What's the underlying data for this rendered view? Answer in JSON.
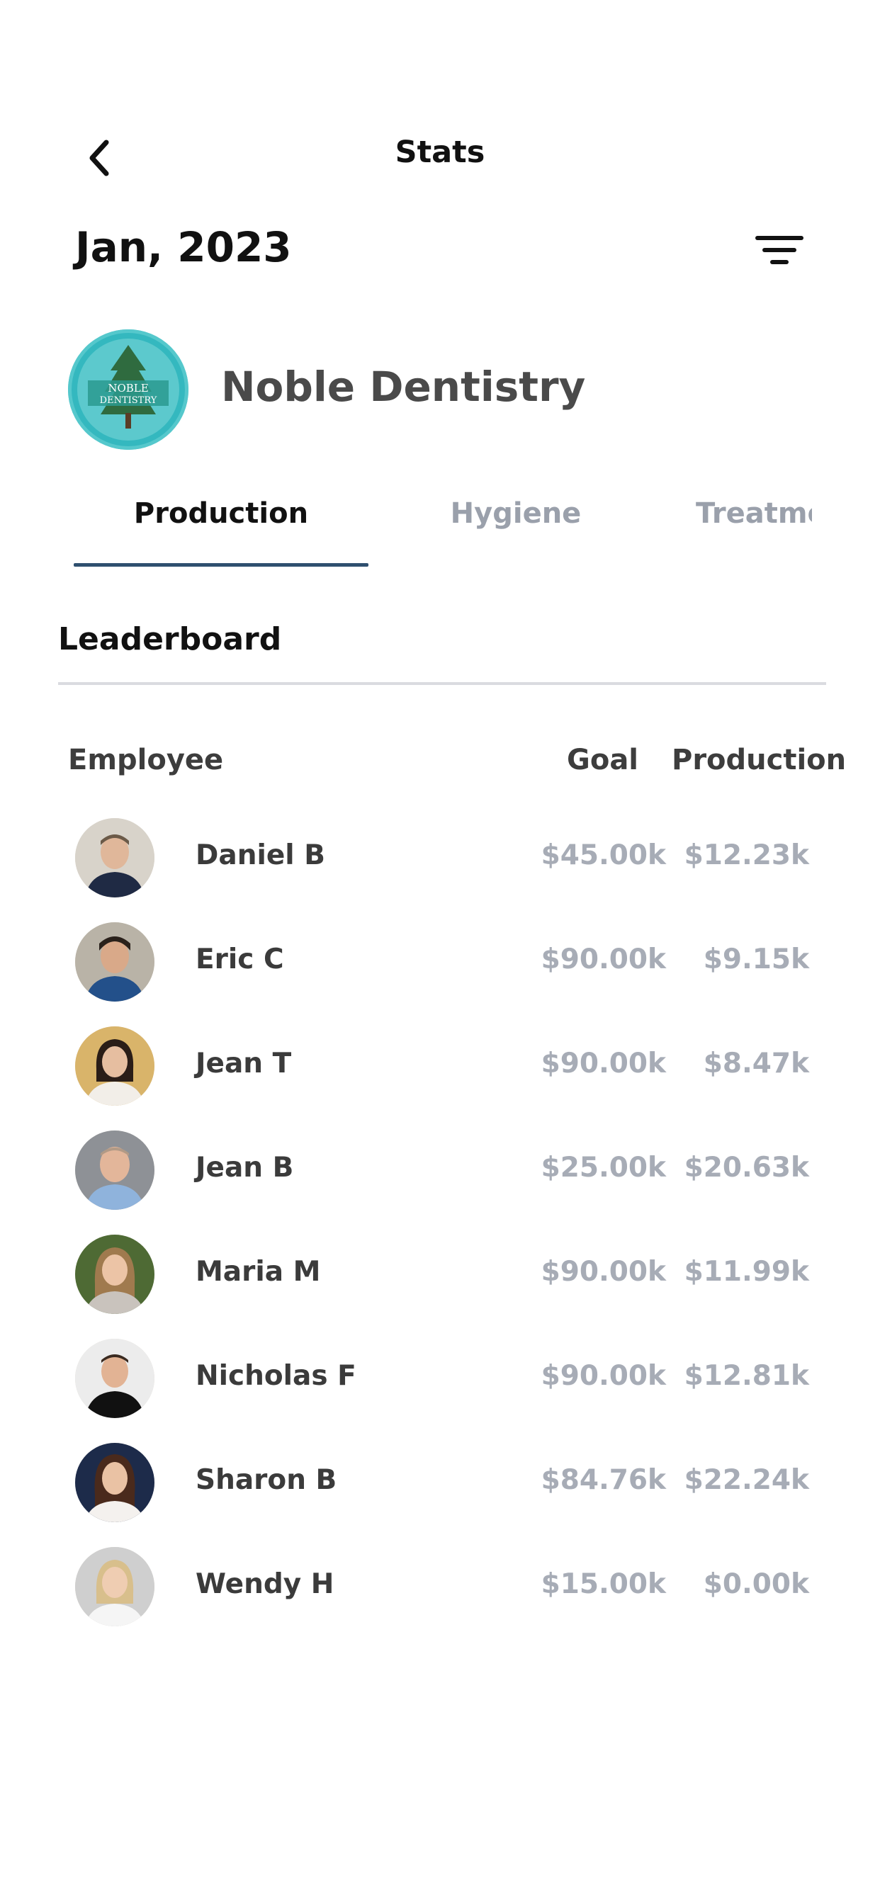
{
  "header": {
    "title": "Stats",
    "back_icon": "chevron-left-icon",
    "filter_icon": "filter-icon"
  },
  "period": {
    "label": "Jan, 2023"
  },
  "practice": {
    "name": "Noble Dentistry",
    "logo_text_line1": "NOBLE",
    "logo_text_line2": "DENTISTRY",
    "logo_color": "#32b7be"
  },
  "tabs": [
    {
      "label": "Production",
      "active": true
    },
    {
      "label": "Hygiene",
      "active": false
    },
    {
      "label": "Treatment",
      "active": false
    }
  ],
  "leaderboard": {
    "title": "Leaderboard",
    "columns": {
      "employee": "Employee",
      "goal": "Goal",
      "production": "Production"
    },
    "rows": [
      {
        "name": "Daniel B",
        "goal": "$45.00k",
        "production": "$12.23k"
      },
      {
        "name": "Eric C",
        "goal": "$90.00k",
        "production": "$9.15k"
      },
      {
        "name": "Jean T",
        "goal": "$90.00k",
        "production": "$8.47k"
      },
      {
        "name": "Jean B",
        "goal": "$25.00k",
        "production": "$20.63k"
      },
      {
        "name": "Maria M",
        "goal": "$90.00k",
        "production": "$11.99k"
      },
      {
        "name": "Nicholas F",
        "goal": "$90.00k",
        "production": "$12.81k"
      },
      {
        "name": "Sharon B",
        "goal": "$84.76k",
        "production": "$22.24k"
      },
      {
        "name": "Wendy H",
        "goal": "$15.00k",
        "production": "$0.00k"
      }
    ]
  },
  "colors": {
    "accent": "#2f4f6f",
    "muted_text": "#a7acb6",
    "inactive_tab": "#9aa0ab"
  }
}
